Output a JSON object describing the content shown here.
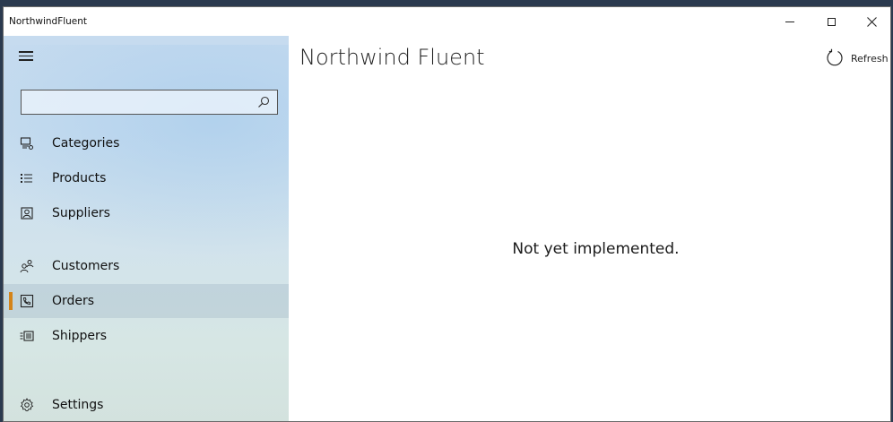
{
  "window": {
    "title": "NorthwindFluent",
    "controls": {
      "minimize": "—",
      "maximize": "☐",
      "close": "✕"
    }
  },
  "sidebar": {
    "menu_icon": "hamburger-icon",
    "search": {
      "placeholder": "",
      "value": "",
      "icon": "search-icon"
    },
    "items": [
      {
        "label": "Categories",
        "icon": "categories-icon",
        "selected": false
      },
      {
        "label": "Products",
        "icon": "products-list-icon",
        "selected": false
      },
      {
        "label": "Suppliers",
        "icon": "suppliers-icon",
        "selected": false
      },
      {
        "label": "Customers",
        "icon": "customers-icon",
        "selected": false
      },
      {
        "label": "Orders",
        "icon": "orders-icon",
        "selected": true
      },
      {
        "label": "Shippers",
        "icon": "shippers-icon",
        "selected": false
      }
    ],
    "settings": {
      "label": "Settings",
      "icon": "gear-icon"
    },
    "accent_color": "#d4841a"
  },
  "main": {
    "title": "Northwind Fluent",
    "refresh_label": "Refresh",
    "message": "Not yet implemented."
  }
}
